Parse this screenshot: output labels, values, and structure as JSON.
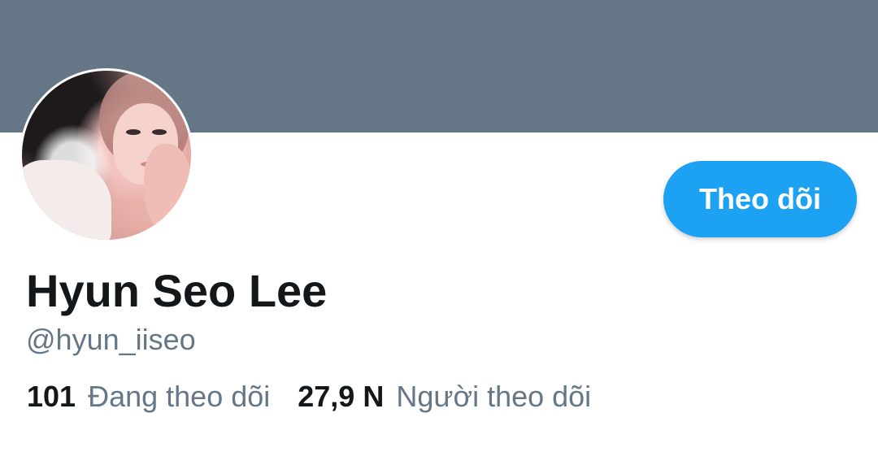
{
  "profile": {
    "name": "Hyun Seo Lee",
    "handle": "@hyun_iiseo",
    "follow_label": "Theo dõi",
    "stats": [
      {
        "number": "101",
        "label": "Đang theo dõi"
      },
      {
        "number": "27,9 N",
        "label": "Người theo dõi"
      }
    ]
  },
  "colors": {
    "banner": "#657786",
    "accent": "#1da1f2",
    "text_primary": "#14171a",
    "text_secondary": "#657786"
  },
  "icons": {
    "avatar": "profile-photo"
  }
}
